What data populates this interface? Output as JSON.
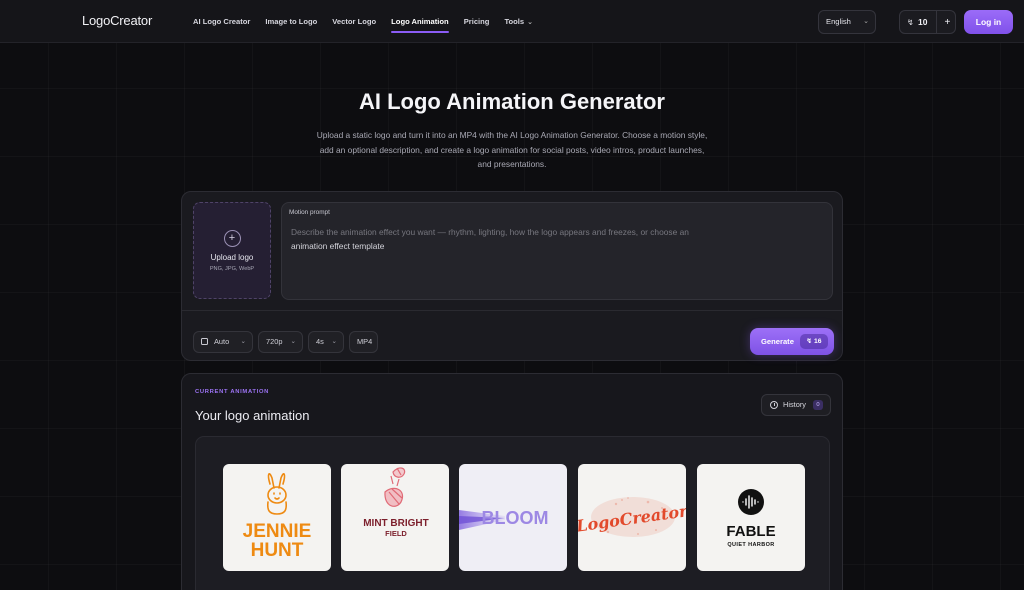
{
  "nav": {
    "logo": "LogoCreator",
    "links": [
      {
        "label": "AI Logo Creator"
      },
      {
        "label": "Image to Logo"
      },
      {
        "label": "Vector Logo"
      },
      {
        "label": "Logo Animation",
        "active": true
      },
      {
        "label": "Pricing"
      },
      {
        "label": "Tools"
      }
    ],
    "language": "English",
    "credits": "10",
    "login": "Log in"
  },
  "hero": {
    "title": "AI Logo Animation Generator",
    "subtitle_lines": [
      "Upload a static logo and turn it into an MP4 with the AI Logo Animation Generator. Choose a motion style,",
      "add an optional description, and create a logo animation for social posts, video intros, product launches,",
      "and presentations."
    ]
  },
  "generator": {
    "upload_label": "Upload logo",
    "upload_formats": "PNG, JPG, WebP",
    "prompt_label": "Motion prompt",
    "prompt_placeholder_line1": "Describe the animation effect you want — rhythm, lighting, how the logo appears and freezes, or choose an",
    "prompt_placeholder_line2": "animation effect template",
    "options": {
      "ratio": "Auto",
      "resolution": "720p",
      "duration": "4s",
      "format": "MP4"
    },
    "generate_label": "Generate",
    "generate_cost": "16"
  },
  "current": {
    "eyebrow": "CURRENT ANIMATION",
    "title": "Your logo animation",
    "history_label": "History",
    "history_count": "0",
    "samples": [
      {
        "line1": "JENNIE",
        "line2": "HUNT",
        "icon": "rabbit-icon",
        "color": "#ee8a12"
      },
      {
        "line1": "MINT BRIGHT",
        "line2": "FIELD",
        "icon": "leaf-icon",
        "color": "#7c1f2c"
      },
      {
        "line1": "BLOOM",
        "icon": "bloom-swirl",
        "color": "#a48fe6"
      },
      {
        "line1": "LogoCreator",
        "icon": "script-wordmark",
        "color": "#e24a2c"
      },
      {
        "line1": "FABLE",
        "line2": "QUIET HARBOR",
        "icon": "waveform-icon",
        "color": "#111111"
      }
    ]
  },
  "colors": {
    "accent": "#8b5cf6",
    "background": "#0d0d10",
    "card": "#1a1a1f"
  }
}
